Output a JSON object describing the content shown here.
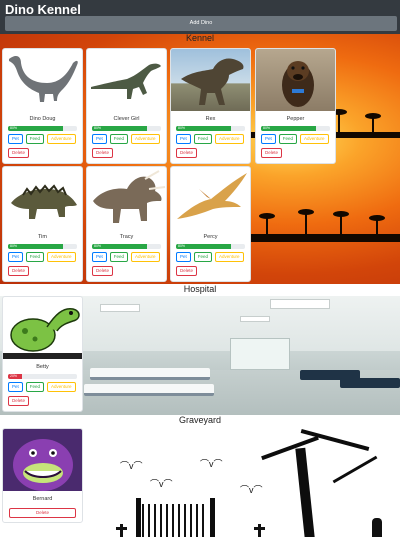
{
  "app": {
    "title": "Dino Kennel",
    "add_button": "Add Dino"
  },
  "sections": {
    "kennel": {
      "title": "Kennel"
    },
    "hospital": {
      "title": "Hospital"
    },
    "graveyard": {
      "title": "Graveyard"
    }
  },
  "buttons": {
    "pet": "Pet",
    "feed": "Feed",
    "adventure": "Adventure",
    "delete": "Delete"
  },
  "dinos": [
    {
      "name": "Dino Doug",
      "health": 0.8,
      "health_label": "80%",
      "status": "kennel",
      "bar_color": "#28a745"
    },
    {
      "name": "Clever Girl",
      "health": 0.8,
      "health_label": "80%",
      "status": "kennel",
      "bar_color": "#28a745"
    },
    {
      "name": "Rex",
      "health": 0.8,
      "health_label": "80%",
      "status": "kennel",
      "bar_color": "#28a745"
    },
    {
      "name": "Pepper",
      "health": 0.8,
      "health_label": "80%",
      "status": "kennel",
      "bar_color": "#28a745"
    },
    {
      "name": "Tim",
      "health": 0.8,
      "health_label": "80%",
      "status": "kennel",
      "bar_color": "#28a745"
    },
    {
      "name": "Tracy",
      "health": 0.8,
      "health_label": "80%",
      "status": "kennel",
      "bar_color": "#28a745"
    },
    {
      "name": "Percy",
      "health": 0.8,
      "health_label": "80%",
      "status": "kennel",
      "bar_color": "#28a745"
    },
    {
      "name": "Betty",
      "health": 0.2,
      "health_label": "20%",
      "status": "hospital",
      "bar_color": "#dc3545"
    },
    {
      "name": "Bernard",
      "status": "graveyard"
    }
  ]
}
